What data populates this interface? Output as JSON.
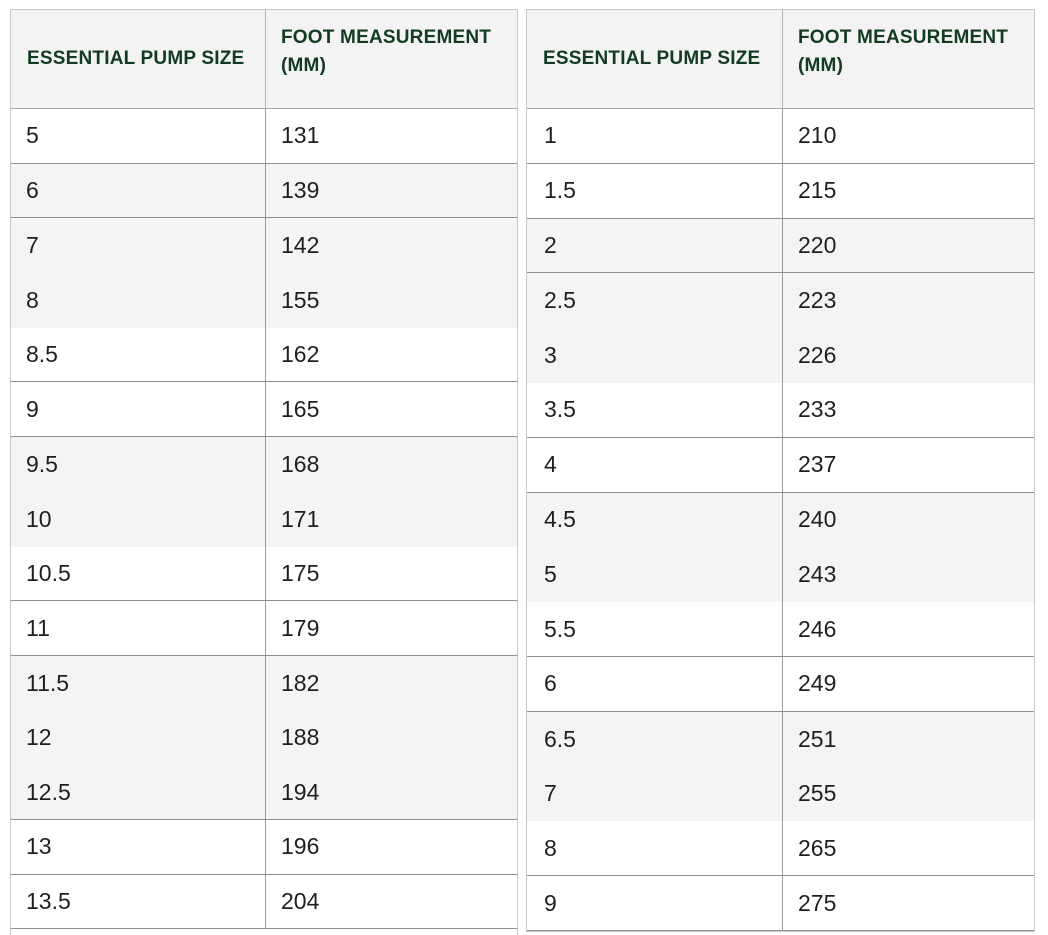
{
  "left_table": {
    "headers": [
      "ESSENTIAL PUMP SIZE",
      "FOOT MEASUREMENT (MM)"
    ],
    "rows": [
      {
        "size": "5",
        "mm": "131"
      },
      {
        "size": "6",
        "mm": "139"
      },
      {
        "size": "7",
        "mm": "142"
      },
      {
        "size": "8",
        "mm": "155"
      },
      {
        "size": "8.5",
        "mm": "162"
      },
      {
        "size": "9",
        "mm": "165"
      },
      {
        "size": "9.5",
        "mm": "168"
      },
      {
        "size": "10",
        "mm": "171"
      },
      {
        "size": "10.5",
        "mm": "175"
      },
      {
        "size": "11",
        "mm": "179"
      },
      {
        "size": "11.5",
        "mm": "182"
      },
      {
        "size": "12",
        "mm": "188"
      },
      {
        "size": "12.5",
        "mm": "194"
      },
      {
        "size": "13",
        "mm": "196"
      },
      {
        "size": "13.5",
        "mm": "204"
      }
    ]
  },
  "right_table": {
    "headers": [
      "ESSENTIAL PUMP SIZE",
      "FOOT MEASUREMENT (MM)"
    ],
    "rows": [
      {
        "size": "1",
        "mm": "210"
      },
      {
        "size": "1.5",
        "mm": "215"
      },
      {
        "size": "2",
        "mm": "220"
      },
      {
        "size": "2.5",
        "mm": "223"
      },
      {
        "size": "3",
        "mm": "226"
      },
      {
        "size": "3.5",
        "mm": "233"
      },
      {
        "size": "4",
        "mm": "237"
      },
      {
        "size": "4.5",
        "mm": "240"
      },
      {
        "size": "5",
        "mm": "243"
      },
      {
        "size": "5.5",
        "mm": "246"
      },
      {
        "size": "6",
        "mm": "249"
      },
      {
        "size": "6.5",
        "mm": "251"
      },
      {
        "size": "7",
        "mm": "255"
      },
      {
        "size": "8",
        "mm": "265"
      },
      {
        "size": "9",
        "mm": "275"
      }
    ]
  },
  "colors": {
    "header_text": "#123b22",
    "header_bg": "#f3f3f3",
    "row_text": "#1f1f1f",
    "row_shade": "#f4f4f4"
  }
}
